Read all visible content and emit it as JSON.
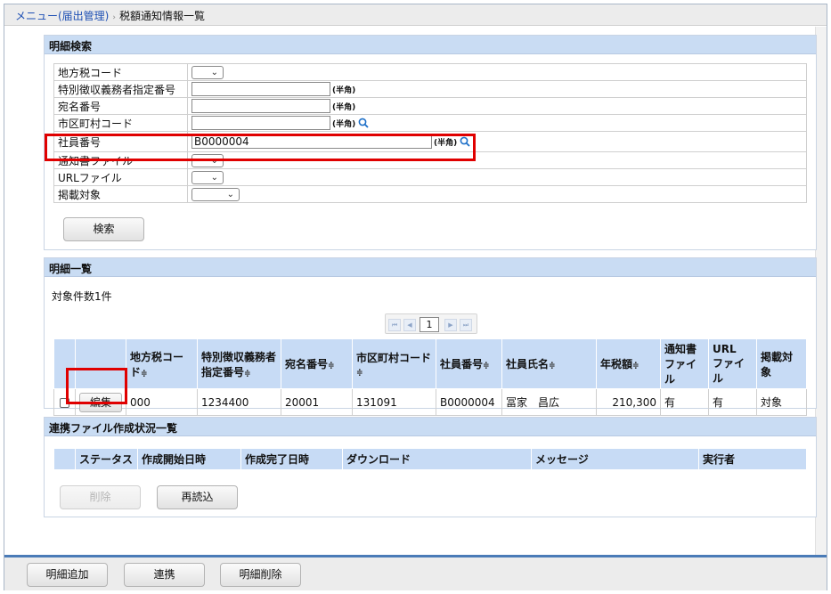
{
  "breadcrumb": {
    "menu_link": "メニュー(届出管理)",
    "separator": "›",
    "current": "税額通知情報一覧"
  },
  "search": {
    "title": "明細検索",
    "fields": {
      "local_tax_code": "地方税コード",
      "designation_number": "特別徴収義務者指定番号",
      "address_number": "宛名番号",
      "municipality_code": "市区町村コード",
      "employee_number": "社員番号",
      "notice_file": "通知書ファイル",
      "url_file": "URLファイル",
      "publish_target": "掲載対象"
    },
    "employee_number_value": "B0000004",
    "half_width_hint": "(半角)",
    "search_button": "検索"
  },
  "detail_list": {
    "title": "明細一覧",
    "count_text": "対象件数1件",
    "pager": {
      "page": "1"
    },
    "columns": [
      "地方税コード",
      "特別徴収義務者\n指定番号",
      "宛名番号",
      "市区町村コード",
      "社員番号",
      "社員氏名",
      "年税額",
      "通知書\nファイル",
      "URL\nファイル",
      "掲載対象"
    ],
    "col": {
      "local_tax_code": "地方税コード",
      "designation_1": "特別徴収義務者",
      "designation_2": "指定番号",
      "address_number": "宛名番号",
      "municipality_code": "市区町村コード",
      "employee_number": "社員番号",
      "employee_name": "社員氏名",
      "annual_tax": "年税額",
      "notice_1": "通知書",
      "notice_2": "ファイル",
      "url_1": "URL",
      "url_2": "ファイル",
      "publish_target": "掲載対象"
    },
    "sort_glyph": "≑",
    "edit_button": "編集",
    "rows": [
      {
        "local_tax_code": "000",
        "designation_number": "1234400",
        "address_number": "20001",
        "municipality_code": "131091",
        "employee_number": "B0000004",
        "employee_name": "冨家　昌広",
        "annual_tax": "210,300",
        "notice_file": "有",
        "url_file": "有",
        "publish_target": "対象"
      }
    ]
  },
  "link_status": {
    "title": "連携ファイル作成状況一覧",
    "col": {
      "status": "ステータス",
      "start": "作成開始日時",
      "end": "作成完了日時",
      "download": "ダウンロード",
      "message": "メッセージ",
      "executor": "実行者"
    },
    "delete_button": "削除",
    "reload_button": "再読込"
  },
  "footer": {
    "add_detail": "明細追加",
    "link": "連携",
    "delete_detail": "明細削除"
  },
  "colors": {
    "section_header": "#c9dcf3",
    "table_header": "#c7dbf5",
    "highlight_border": "#e00000",
    "link": "#1d4fb4",
    "footer_border": "#4a7bb7"
  }
}
